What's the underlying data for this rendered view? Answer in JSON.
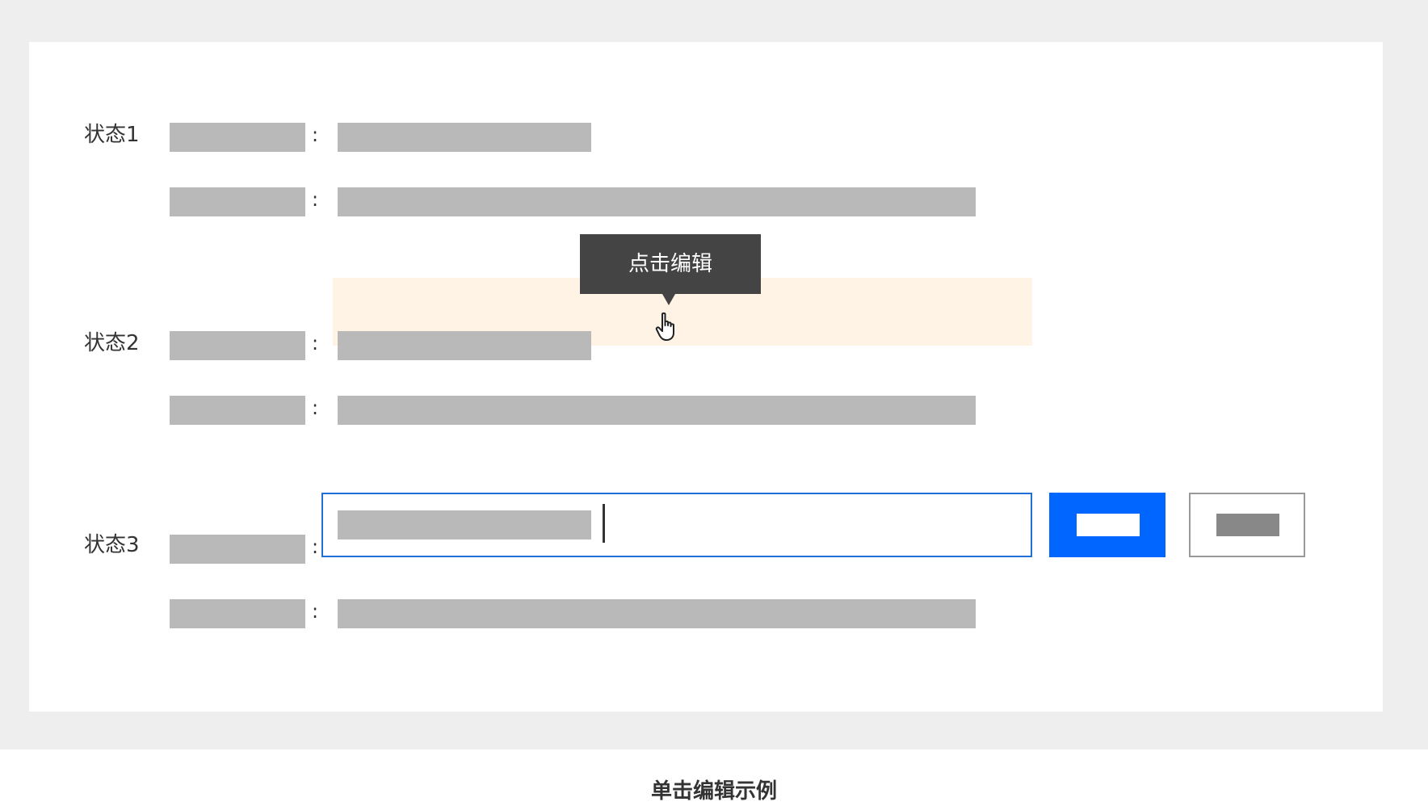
{
  "states": [
    {
      "label": "状态1"
    },
    {
      "label": "状态2"
    },
    {
      "label": "状态3"
    }
  ],
  "colon": ":",
  "tooltip": {
    "text": "点击编辑"
  },
  "caption": "单击编辑示例",
  "colors": {
    "page_bg": "#eeeeee",
    "panel_bg": "#ffffff",
    "skeleton": "#b9b9b9",
    "hover_bg": "#fff3e5",
    "tooltip_bg": "#444444",
    "input_border": "#1f6fd6",
    "primary": "#0066ff",
    "cancel_border": "#999999"
  },
  "icons": {
    "cursor": "hand-pointer-icon"
  }
}
